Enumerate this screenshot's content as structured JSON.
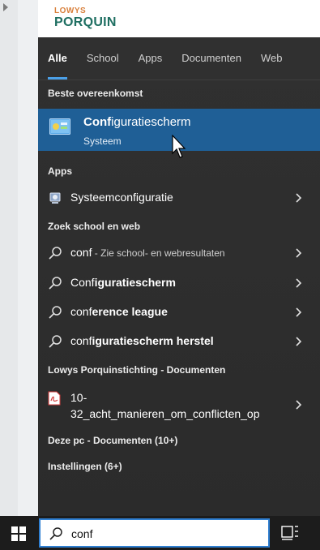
{
  "logo": {
    "line1": "LOWYS",
    "line2": "PORQUIN"
  },
  "tabs": [
    {
      "label": "Alle",
      "active": true
    },
    {
      "label": "School",
      "active": false
    },
    {
      "label": "Apps",
      "active": false
    },
    {
      "label": "Documenten",
      "active": false
    },
    {
      "label": "Web",
      "active": false
    }
  ],
  "best_match": {
    "section": "Beste overeenkomst",
    "title_match": "Conf",
    "title_rest": "iguratiescherm",
    "subtitle": "Systeem",
    "icon": "control-panel-icon"
  },
  "apps": {
    "section": "Apps",
    "items": [
      {
        "match": "Systeem",
        "rest": "configuratie",
        "icon": "system-config-icon"
      }
    ]
  },
  "web": {
    "section": "Zoek school en web",
    "items": [
      {
        "match": "conf",
        "rest": "",
        "hint": " - Zie school- en webresultaten"
      },
      {
        "match": "Conf",
        "rest": "iguratiescherm",
        "hint": ""
      },
      {
        "match": "conf",
        "rest": "erence league",
        "hint": ""
      },
      {
        "match": "conf",
        "rest": "iguratiescherm herstel",
        "hint": ""
      }
    ]
  },
  "docs": {
    "section": "Lowys Porquinstichting - Documenten",
    "item": {
      "line1": "10-",
      "line2": "32_acht_manieren_om_conflicten_op",
      "icon": "pdf-icon"
    }
  },
  "this_pc": {
    "section": "Deze pc - Documenten (10+)"
  },
  "settings": {
    "section": "Instellingen (6+)"
  },
  "taskbar": {
    "search_value": "conf"
  },
  "colors": {
    "accent": "#1f5f96",
    "panel": "#2c2c2c",
    "tab_underline": "#4ba0e8"
  }
}
